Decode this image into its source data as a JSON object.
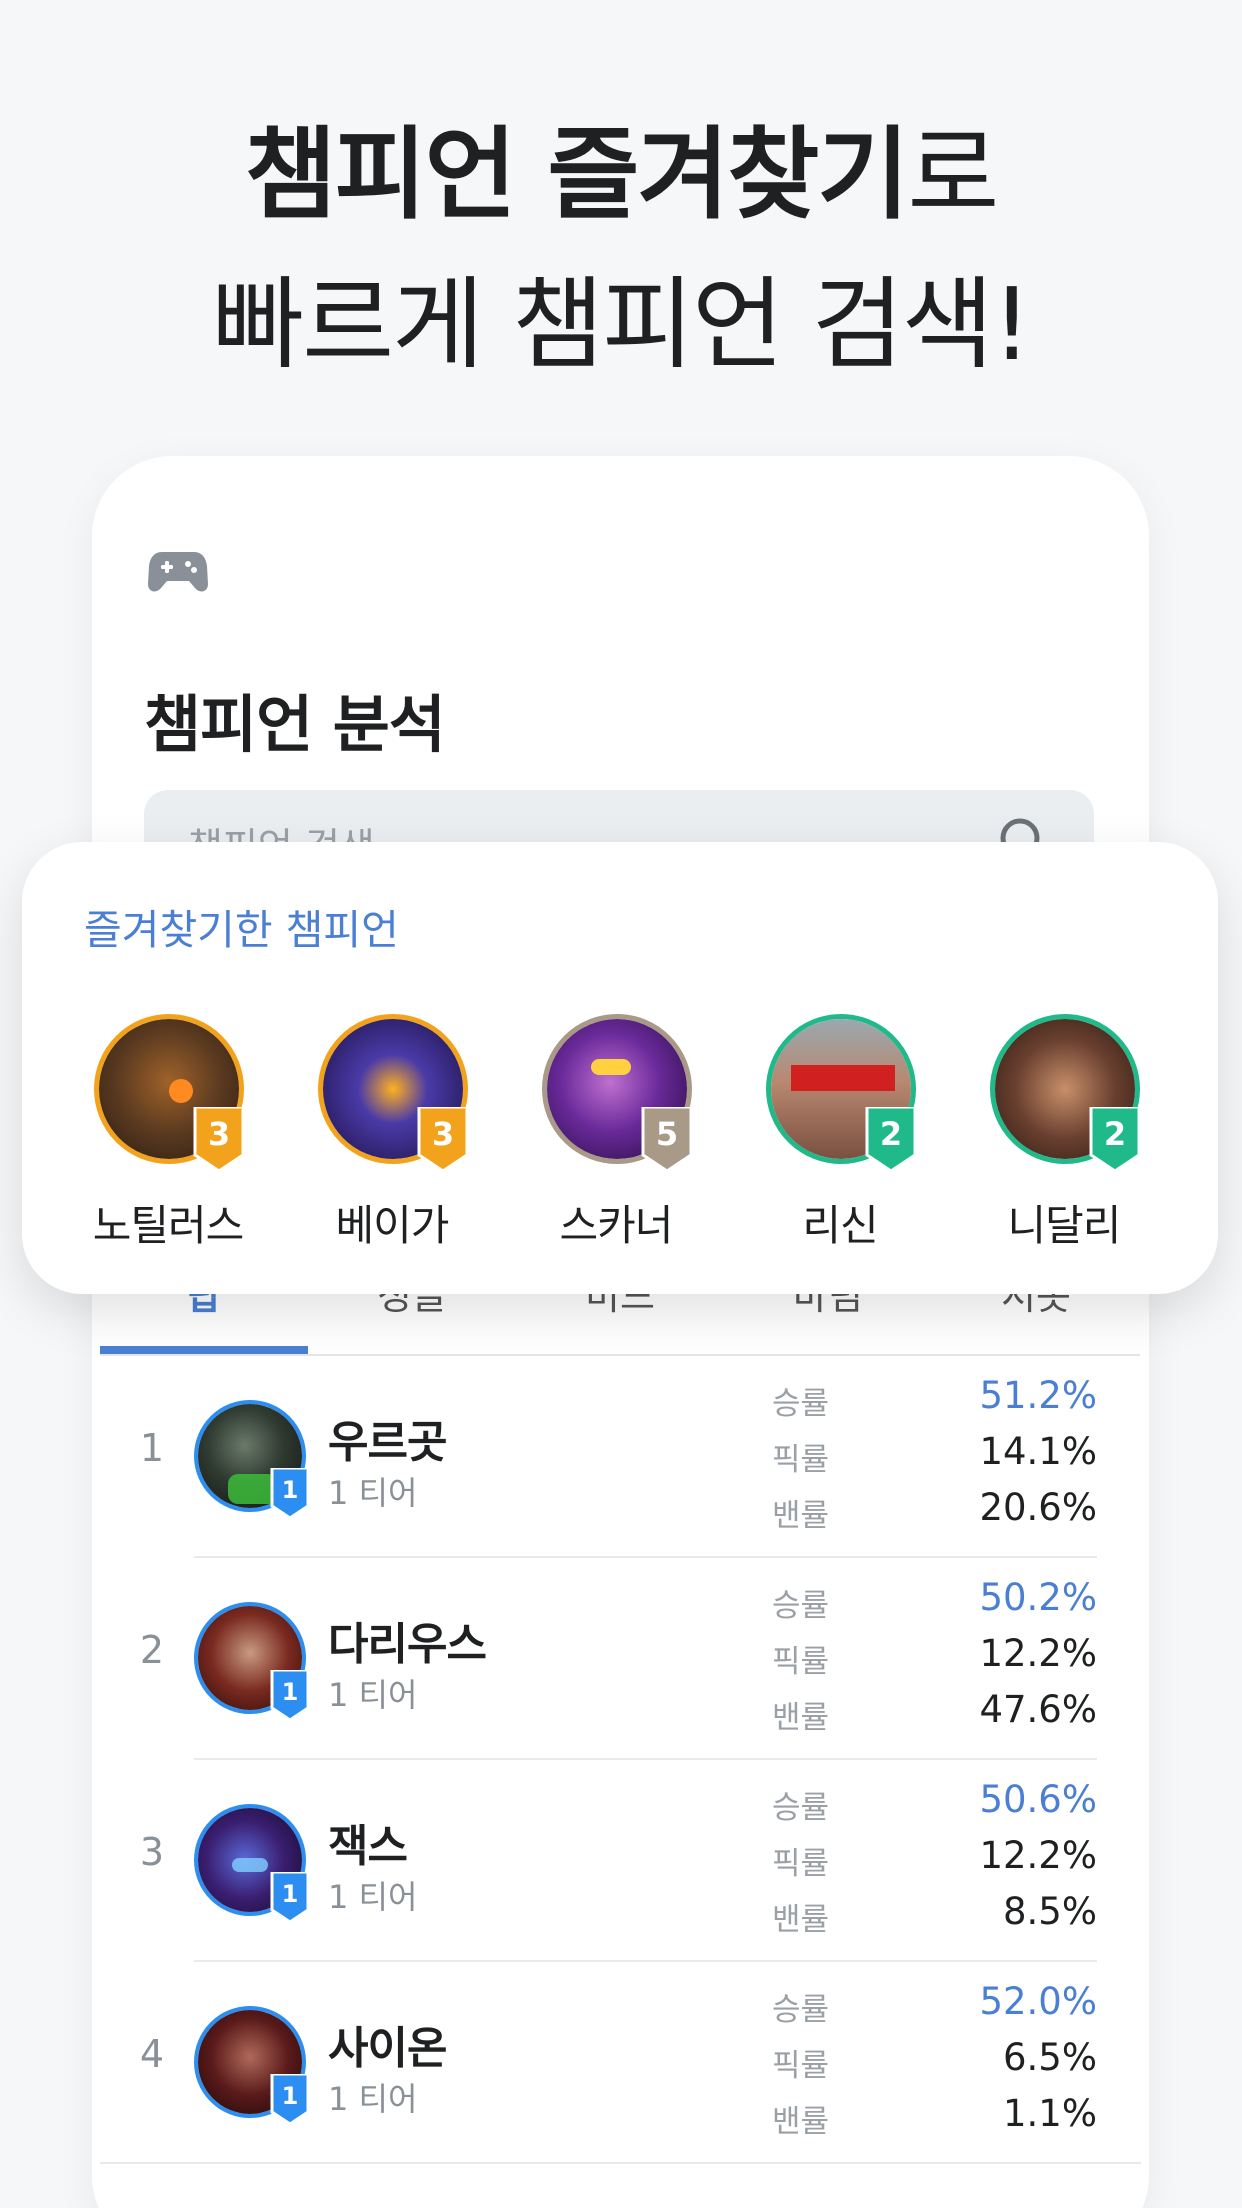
{
  "headline": {
    "line1_bold": "챔피언 즐겨찾기",
    "line1_light": "로",
    "line2": "빠르게 챔피언 검색!"
  },
  "app": {
    "title": "챔피언 분석",
    "icon": "gamepad-icon",
    "search": {
      "placeholder": "챔피언 검색",
      "icon": "search-icon"
    }
  },
  "tabs": [
    {
      "label": "탑",
      "active": true
    },
    {
      "label": "정글",
      "active": false
    },
    {
      "label": "미드",
      "active": false
    },
    {
      "label": "바텀",
      "active": false
    },
    {
      "label": "서폿",
      "active": false
    }
  ],
  "stat_labels": {
    "win": "승률",
    "pick": "픽률",
    "ban": "밴률"
  },
  "rankings": [
    {
      "rank": "1",
      "name": "우르곳",
      "tier": "1 티어",
      "tier_badge": "1",
      "win": "51.2%",
      "pick": "14.1%",
      "ban": "20.6%"
    },
    {
      "rank": "2",
      "name": "다리우스",
      "tier": "1 티어",
      "tier_badge": "1",
      "win": "50.2%",
      "pick": "12.2%",
      "ban": "47.6%"
    },
    {
      "rank": "3",
      "name": "잭스",
      "tier": "1 티어",
      "tier_badge": "1",
      "win": "50.6%",
      "pick": "12.2%",
      "ban": "8.5%"
    },
    {
      "rank": "4",
      "name": "사이온",
      "tier": "1 티어",
      "tier_badge": "1",
      "win": "52.0%",
      "pick": "6.5%",
      "ban": "1.1%"
    }
  ],
  "favorites": {
    "title": "즐겨찾기한 챔피언",
    "items": [
      {
        "name": "노틸러스",
        "tier_badge": "3",
        "color": "#f2a31b"
      },
      {
        "name": "베이가",
        "tier_badge": "3",
        "color": "#f2a31b"
      },
      {
        "name": "스카너",
        "tier_badge": "5",
        "color": "#a89a86"
      },
      {
        "name": "리신",
        "tier_badge": "2",
        "color": "#1fb98a"
      },
      {
        "name": "니달리",
        "tier_badge": "2",
        "color": "#1fb98a"
      }
    ]
  },
  "colors": {
    "accent": "#4a7fd4",
    "tier1": "#2b8ef0",
    "tier2": "#1fb98a",
    "tier3": "#f2a31b",
    "tier5": "#a89a86"
  }
}
